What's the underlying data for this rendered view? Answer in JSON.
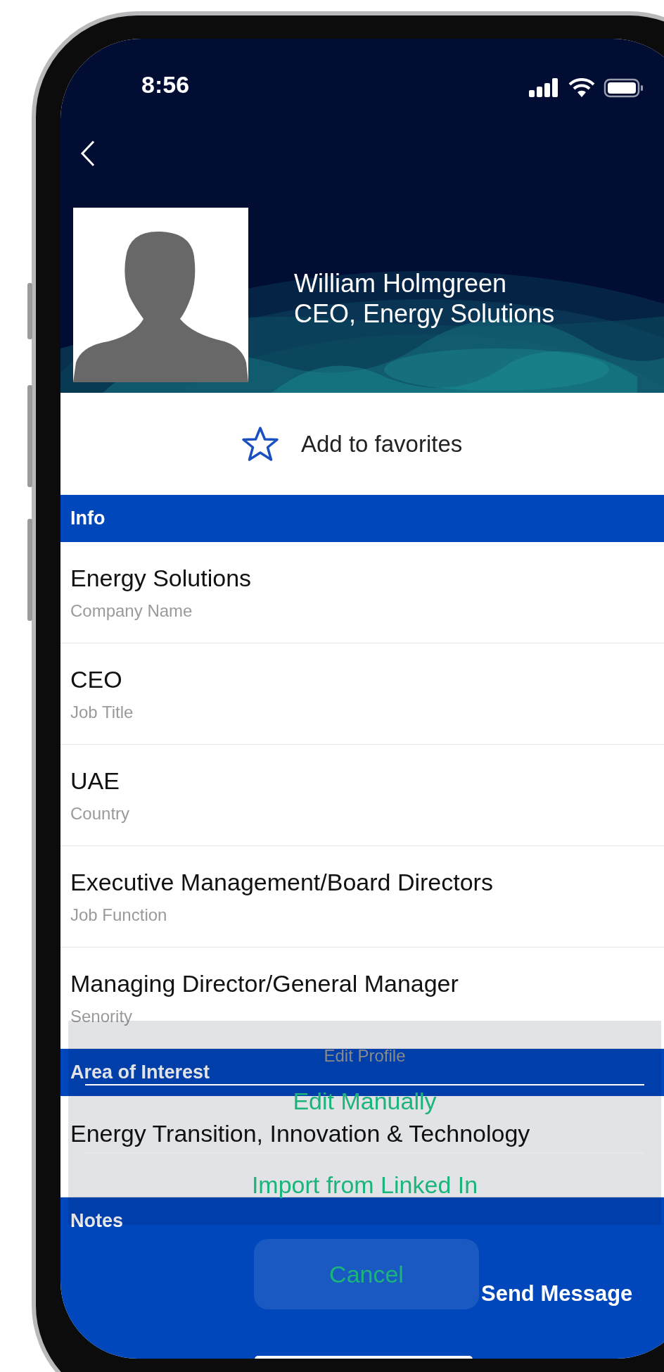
{
  "status_bar": {
    "time": "8:56"
  },
  "profile": {
    "name": "William Holmgreen",
    "headline": "CEO, Energy Solutions"
  },
  "favorite": {
    "label": "Add to favorites",
    "on": false
  },
  "sections": [
    {
      "title": "Info",
      "fields": [
        {
          "value": "Energy Solutions",
          "label": "Company Name"
        },
        {
          "value": "CEO",
          "label": "Job Title"
        },
        {
          "value": "UAE",
          "label": "Country"
        },
        {
          "value": "Executive Management/Board Directors",
          "label": "Job Function"
        },
        {
          "value": "Managing Director/General Manager",
          "label": "Senority"
        }
      ]
    },
    {
      "title": "Area of Interest",
      "fields": [
        {
          "value": "Energy Transition, Innovation & Technology"
        }
      ]
    },
    {
      "title": "Notes"
    }
  ],
  "action_sheet": {
    "title": "Edit Profile",
    "options": [
      "Edit Manually",
      "Import from Linked In"
    ],
    "cancel": "Cancel"
  },
  "bottom_bar": {
    "action": "Send Message"
  }
}
